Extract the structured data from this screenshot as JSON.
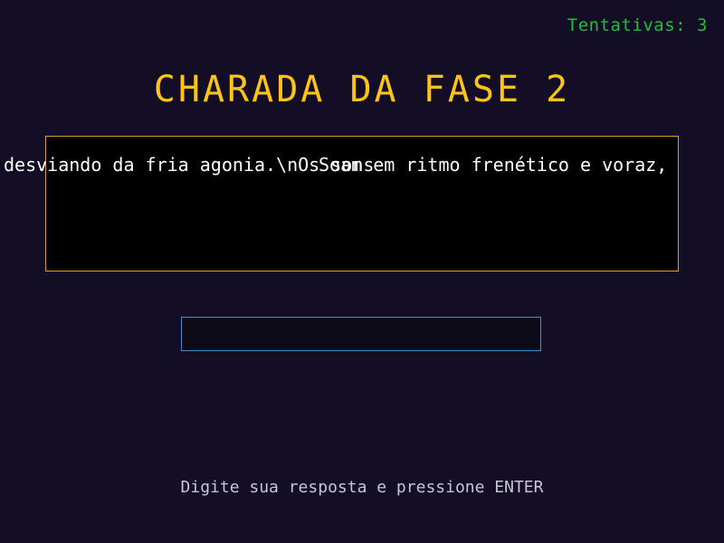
{
  "hud": {
    "attempts_label": "Tentativas:",
    "attempts_value": "3"
  },
  "riddle": {
    "title": "CHARADA DA FASE 2",
    "line_left": "desviando da fria agonia.\\nOs sons",
    "line_right": "Soam em ritmo frenético e voraz,"
  },
  "answer": {
    "value": "",
    "placeholder": ""
  },
  "footer": {
    "instruction": "Digite sua resposta e pressione ENTER"
  },
  "colors": {
    "background": "#140d26",
    "title": "#ffc414",
    "attempts": "#1fbf3a",
    "box_border": "#d9a21c",
    "input_border": "#3f8fd6"
  }
}
